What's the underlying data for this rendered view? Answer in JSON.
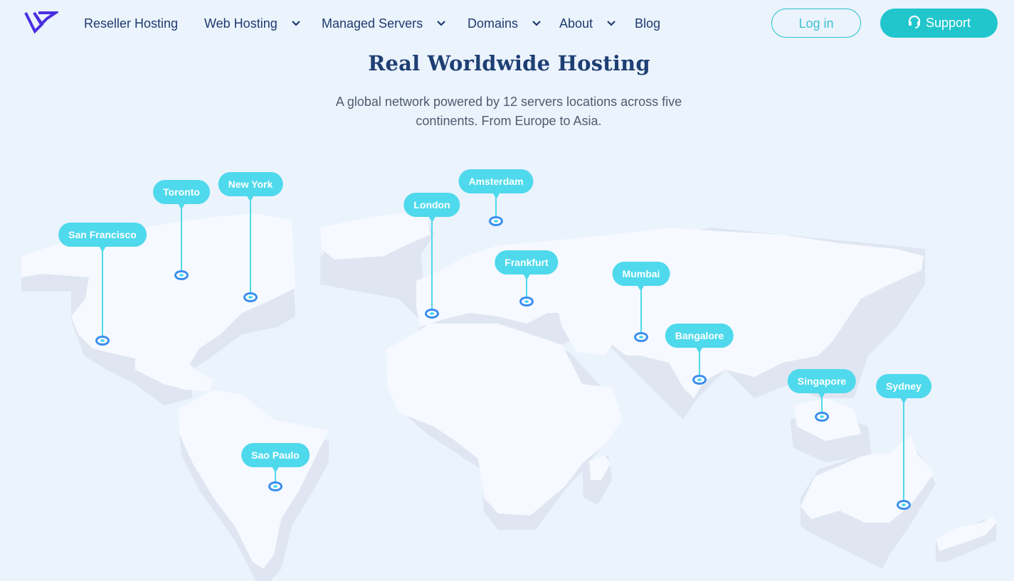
{
  "nav": {
    "logo_alt": "logo",
    "items": [
      {
        "label": "Reseller Hosting",
        "has_dropdown": false
      },
      {
        "label": "Web Hosting",
        "has_dropdown": true
      },
      {
        "label": "Managed Servers",
        "has_dropdown": true
      },
      {
        "label": "Domains",
        "has_dropdown": true
      },
      {
        "label": "About",
        "has_dropdown": true
      },
      {
        "label": "Blog",
        "has_dropdown": false
      }
    ],
    "login_label": "Log in",
    "support_label": "Support"
  },
  "hero": {
    "title": "Real Worldwide Hosting",
    "subtitle": "A global network powered by 12 servers locations across five continents. From Europe to Asia."
  },
  "map": {
    "locations": [
      {
        "name": "San Francisco"
      },
      {
        "name": "Toronto"
      },
      {
        "name": "New York"
      },
      {
        "name": "London"
      },
      {
        "name": "Amsterdam"
      },
      {
        "name": "Frankfurt"
      },
      {
        "name": "Mumbai"
      },
      {
        "name": "Bangalore"
      },
      {
        "name": "Singapore"
      },
      {
        "name": "Sydney"
      },
      {
        "name": "Sao Paulo"
      }
    ]
  },
  "colors": {
    "accent": "#20c6cc",
    "pin": "#4fd9ec",
    "pin_ring": "#3a8df0",
    "nav_text": "#1e3a6e",
    "logo": "#4a2de0",
    "background": "#ebf3fd"
  }
}
